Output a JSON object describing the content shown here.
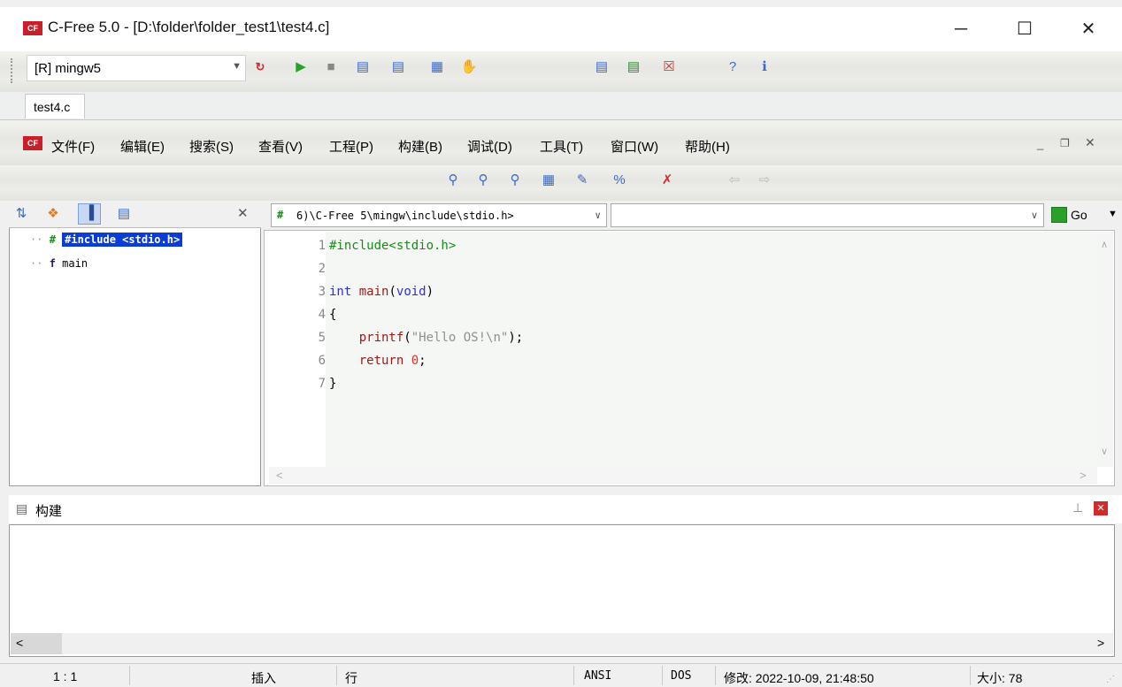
{
  "window": {
    "title": "C-Free 5.0 - [D:\\folder\\folder_test1\\test4.c]",
    "app_icon_text": "CF",
    "controls": {
      "minimize": "─",
      "maximize": "☐",
      "close": "✕"
    }
  },
  "toolbar": {
    "compiler_select": "[R] mingw5"
  },
  "tabs": [
    {
      "label": "test4.c"
    }
  ],
  "menu": [
    {
      "label": "文件(F)"
    },
    {
      "label": "编辑(E)"
    },
    {
      "label": "搜索(S)"
    },
    {
      "label": "查看(V)"
    },
    {
      "label": "工程(P)"
    },
    {
      "label": "构建(B)"
    },
    {
      "label": "调试(D)"
    },
    {
      "label": "工具(T)"
    },
    {
      "label": "窗口(W)"
    },
    {
      "label": "帮助(H)"
    }
  ],
  "outline": {
    "items": [
      {
        "icon": "#",
        "label": "#include <stdio.h>",
        "selected": true
      },
      {
        "icon": "f",
        "label": "main",
        "selected": false
      }
    ]
  },
  "editor": {
    "file_combo": "6)\\C-Free 5\\mingw\\include\\stdio.h>",
    "go_label": "Go",
    "lines": [
      {
        "no": "1",
        "text": "#include<stdio.h>"
      },
      {
        "no": "2",
        "text": ""
      },
      {
        "no": "3",
        "text": "int main(void)"
      },
      {
        "no": "4",
        "text": "{"
      },
      {
        "no": "5",
        "text": "    printf(\"Hello OS!\\n\");"
      },
      {
        "no": "6",
        "text": "    return 0;"
      },
      {
        "no": "7",
        "text": "}"
      }
    ]
  },
  "build_panel": {
    "title": "构建"
  },
  "status": {
    "position": "1 :  1",
    "insert": "插入",
    "mode": "行",
    "encoding": "ANSI",
    "line_ending": "DOS",
    "modified": "修改: 2022-10-09, 21:48:50",
    "size": "大小: 78"
  },
  "colors": {
    "keyword": "#3030c8",
    "preprocessor": "#1a8a1a",
    "function": "#a01818",
    "string": "#909090",
    "number": "#e03030",
    "selection": "#0a3dd8"
  }
}
